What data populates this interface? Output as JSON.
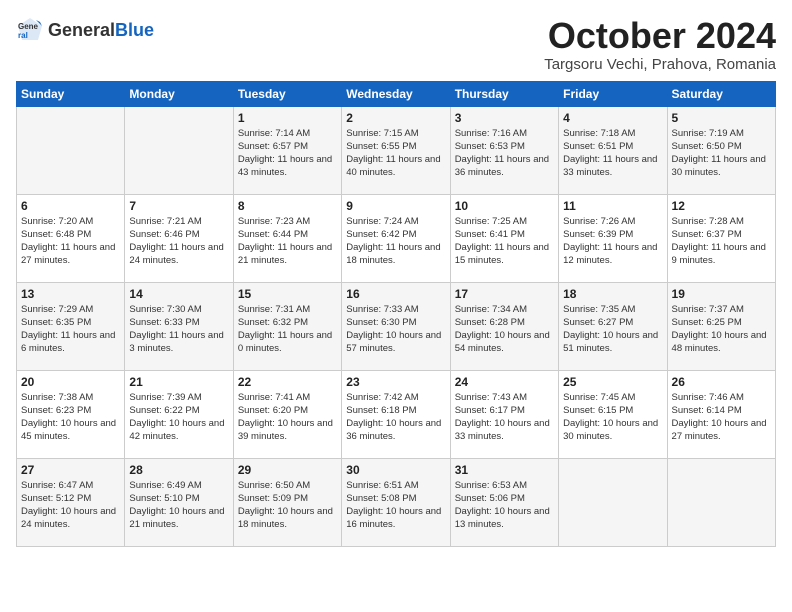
{
  "header": {
    "logo_general": "General",
    "logo_blue": "Blue",
    "month_year": "October 2024",
    "location": "Targsoru Vechi, Prahova, Romania"
  },
  "days_of_week": [
    "Sunday",
    "Monday",
    "Tuesday",
    "Wednesday",
    "Thursday",
    "Friday",
    "Saturday"
  ],
  "weeks": [
    [
      {
        "day": "",
        "content": ""
      },
      {
        "day": "",
        "content": ""
      },
      {
        "day": "1",
        "content": "Sunrise: 7:14 AM\nSunset: 6:57 PM\nDaylight: 11 hours and 43 minutes."
      },
      {
        "day": "2",
        "content": "Sunrise: 7:15 AM\nSunset: 6:55 PM\nDaylight: 11 hours and 40 minutes."
      },
      {
        "day": "3",
        "content": "Sunrise: 7:16 AM\nSunset: 6:53 PM\nDaylight: 11 hours and 36 minutes."
      },
      {
        "day": "4",
        "content": "Sunrise: 7:18 AM\nSunset: 6:51 PM\nDaylight: 11 hours and 33 minutes."
      },
      {
        "day": "5",
        "content": "Sunrise: 7:19 AM\nSunset: 6:50 PM\nDaylight: 11 hours and 30 minutes."
      }
    ],
    [
      {
        "day": "6",
        "content": "Sunrise: 7:20 AM\nSunset: 6:48 PM\nDaylight: 11 hours and 27 minutes."
      },
      {
        "day": "7",
        "content": "Sunrise: 7:21 AM\nSunset: 6:46 PM\nDaylight: 11 hours and 24 minutes."
      },
      {
        "day": "8",
        "content": "Sunrise: 7:23 AM\nSunset: 6:44 PM\nDaylight: 11 hours and 21 minutes."
      },
      {
        "day": "9",
        "content": "Sunrise: 7:24 AM\nSunset: 6:42 PM\nDaylight: 11 hours and 18 minutes."
      },
      {
        "day": "10",
        "content": "Sunrise: 7:25 AM\nSunset: 6:41 PM\nDaylight: 11 hours and 15 minutes."
      },
      {
        "day": "11",
        "content": "Sunrise: 7:26 AM\nSunset: 6:39 PM\nDaylight: 11 hours and 12 minutes."
      },
      {
        "day": "12",
        "content": "Sunrise: 7:28 AM\nSunset: 6:37 PM\nDaylight: 11 hours and 9 minutes."
      }
    ],
    [
      {
        "day": "13",
        "content": "Sunrise: 7:29 AM\nSunset: 6:35 PM\nDaylight: 11 hours and 6 minutes."
      },
      {
        "day": "14",
        "content": "Sunrise: 7:30 AM\nSunset: 6:33 PM\nDaylight: 11 hours and 3 minutes."
      },
      {
        "day": "15",
        "content": "Sunrise: 7:31 AM\nSunset: 6:32 PM\nDaylight: 11 hours and 0 minutes."
      },
      {
        "day": "16",
        "content": "Sunrise: 7:33 AM\nSunset: 6:30 PM\nDaylight: 10 hours and 57 minutes."
      },
      {
        "day": "17",
        "content": "Sunrise: 7:34 AM\nSunset: 6:28 PM\nDaylight: 10 hours and 54 minutes."
      },
      {
        "day": "18",
        "content": "Sunrise: 7:35 AM\nSunset: 6:27 PM\nDaylight: 10 hours and 51 minutes."
      },
      {
        "day": "19",
        "content": "Sunrise: 7:37 AM\nSunset: 6:25 PM\nDaylight: 10 hours and 48 minutes."
      }
    ],
    [
      {
        "day": "20",
        "content": "Sunrise: 7:38 AM\nSunset: 6:23 PM\nDaylight: 10 hours and 45 minutes."
      },
      {
        "day": "21",
        "content": "Sunrise: 7:39 AM\nSunset: 6:22 PM\nDaylight: 10 hours and 42 minutes."
      },
      {
        "day": "22",
        "content": "Sunrise: 7:41 AM\nSunset: 6:20 PM\nDaylight: 10 hours and 39 minutes."
      },
      {
        "day": "23",
        "content": "Sunrise: 7:42 AM\nSunset: 6:18 PM\nDaylight: 10 hours and 36 minutes."
      },
      {
        "day": "24",
        "content": "Sunrise: 7:43 AM\nSunset: 6:17 PM\nDaylight: 10 hours and 33 minutes."
      },
      {
        "day": "25",
        "content": "Sunrise: 7:45 AM\nSunset: 6:15 PM\nDaylight: 10 hours and 30 minutes."
      },
      {
        "day": "26",
        "content": "Sunrise: 7:46 AM\nSunset: 6:14 PM\nDaylight: 10 hours and 27 minutes."
      }
    ],
    [
      {
        "day": "27",
        "content": "Sunrise: 6:47 AM\nSunset: 5:12 PM\nDaylight: 10 hours and 24 minutes."
      },
      {
        "day": "28",
        "content": "Sunrise: 6:49 AM\nSunset: 5:10 PM\nDaylight: 10 hours and 21 minutes."
      },
      {
        "day": "29",
        "content": "Sunrise: 6:50 AM\nSunset: 5:09 PM\nDaylight: 10 hours and 18 minutes."
      },
      {
        "day": "30",
        "content": "Sunrise: 6:51 AM\nSunset: 5:08 PM\nDaylight: 10 hours and 16 minutes."
      },
      {
        "day": "31",
        "content": "Sunrise: 6:53 AM\nSunset: 5:06 PM\nDaylight: 10 hours and 13 minutes."
      },
      {
        "day": "",
        "content": ""
      },
      {
        "day": "",
        "content": ""
      }
    ]
  ]
}
